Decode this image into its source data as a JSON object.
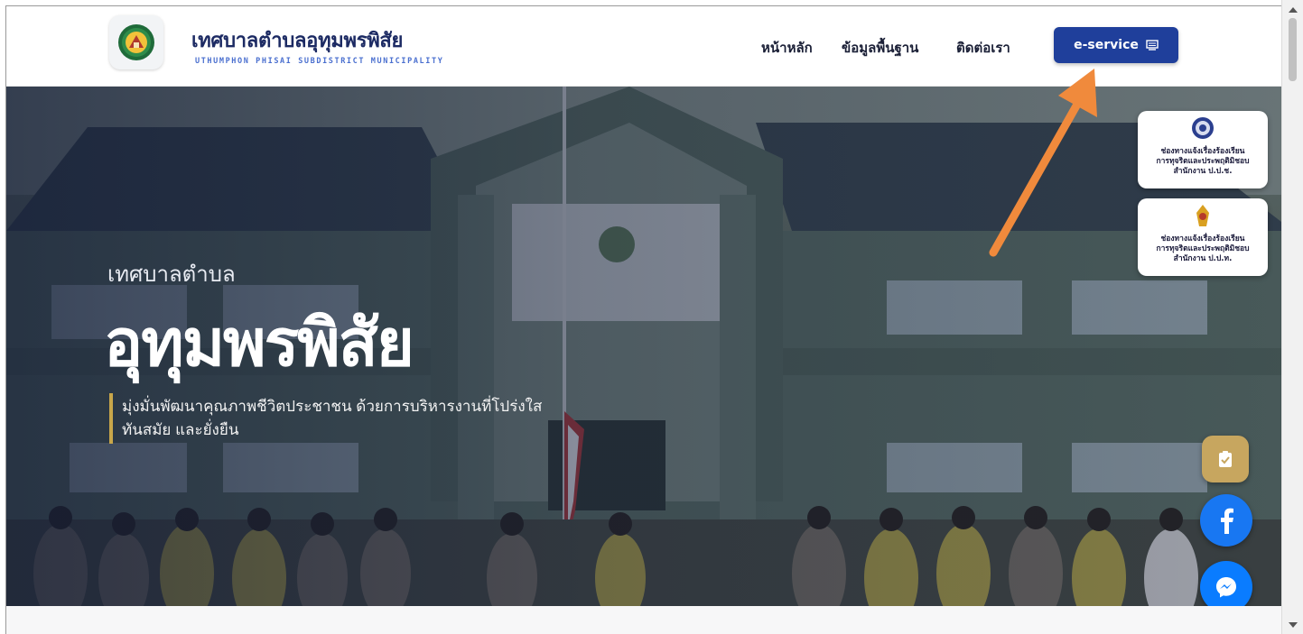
{
  "header": {
    "site_title": "เทศบาลตำบลอุทุมพรพิสัย",
    "site_subtitle": "UTHUMPHON PHISAI SUBDISTRICT MUNICIPALITY",
    "nav": [
      "หน้าหลัก",
      "ข้อมูลพื้นฐาน",
      "ติดต่อเรา"
    ],
    "eservice_label": "e-service"
  },
  "hero": {
    "small_title": "เทศบาลตำบล",
    "big_title": "อุทุมพรพิสัย",
    "description_line1": "มุ่งมั่นพัฒนาคุณภาพชีวิตประชาชน ด้วยการบริหารงานที่โปร่งใส",
    "description_line2": "ทันสมัย และยั่งยืน"
  },
  "side_cards": [
    {
      "text": "ช่องทางแจ้งเรื่องร้องเรียน\nการทุจริตและประพฤติมิชอบ\nสำนักงาน ป.ป.ช."
    },
    {
      "text": "ช่องทางแจ้งเรื่องร้องเรียน\nการทุจริตและประพฤติมิชอบ\nสำนักงาน ป.ป.ท."
    }
  ],
  "colors": {
    "brand_navy": "#1c2a63",
    "button_blue": "#1f3f9b",
    "accent_gold": "#c8a64a",
    "facebook_blue": "#1877f2",
    "messenger_blue": "#0a7cff",
    "annotation_orange": "#f08a3c"
  },
  "icons": {
    "eservice": "monitor-icon",
    "clipboard": "clipboard-check-icon",
    "facebook": "facebook-icon",
    "messenger": "messenger-icon"
  }
}
